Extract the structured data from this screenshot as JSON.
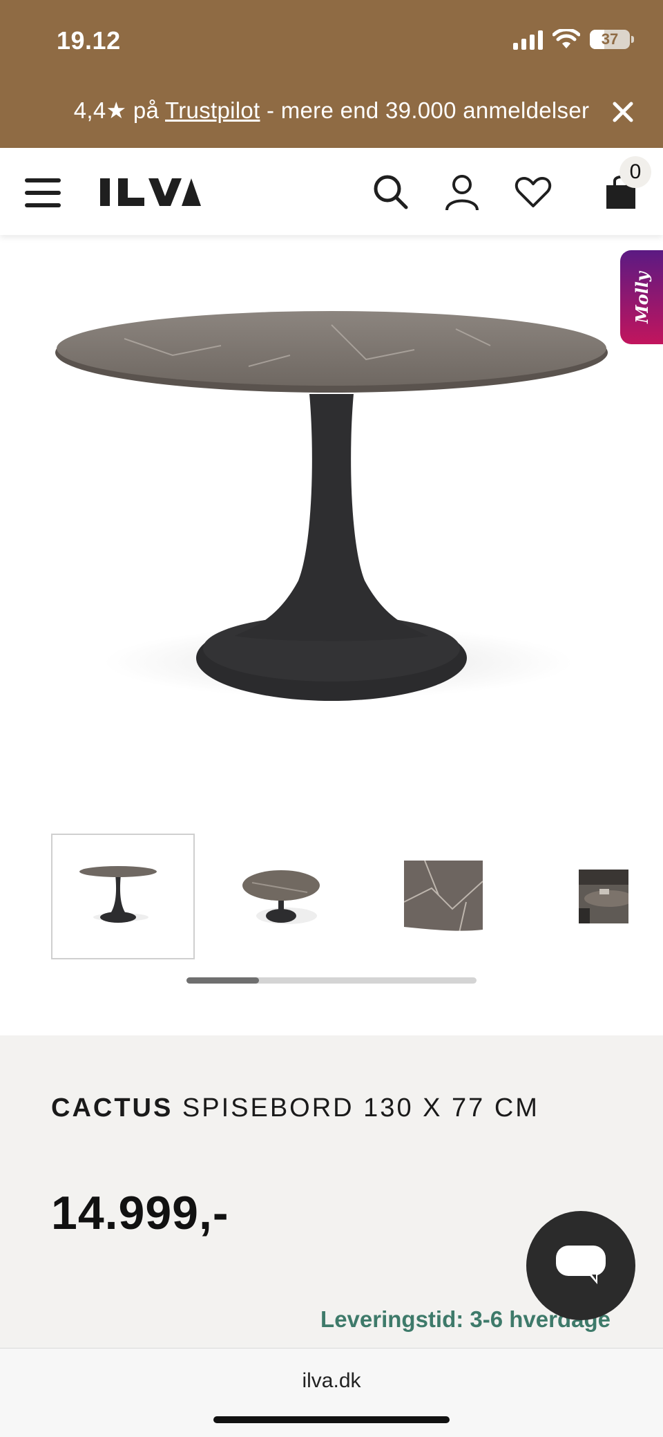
{
  "status_bar": {
    "time": "19.12",
    "battery": "37",
    "battery_level": 0.37
  },
  "promo": {
    "rating": "4,4★ på ",
    "link": "Trustpilot",
    "suffix": " - mere end 39.000 anmeldelser",
    "close_icon": "close-icon"
  },
  "header": {
    "logo": "ILVA",
    "icons": [
      "menu-icon",
      "search-icon",
      "account-icon",
      "heart-icon",
      "bag-icon"
    ],
    "cart_count": "0"
  },
  "assistant_tab": {
    "label": "Molly"
  },
  "gallery": {
    "thumbnails": [
      "table-side-view",
      "table-top-angle",
      "marble-detail",
      "room-scene"
    ],
    "active_index": 0,
    "scroll_fraction": 0.25
  },
  "product": {
    "brand": "CACTUS",
    "name": " SPISEBORD 130 X 77 CM",
    "price": "14.999,-",
    "delivery": "Leveringstid: 3-6 hverdage"
  },
  "browser": {
    "url": "ilva.dk"
  },
  "colors": {
    "top_band": "#8f6b44",
    "info_bg": "#f3f2f0",
    "delivery_green": "#3e7a6a",
    "chat_button": "#2b2b2b"
  }
}
